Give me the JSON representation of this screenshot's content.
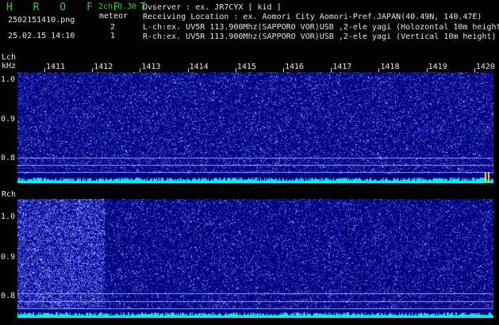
{
  "header": {
    "app_title": "H R O F F T",
    "mode": "2ch",
    "version": "0.30",
    "filename": "2502151410.png",
    "meteor_label": "meteor",
    "meteor_lch": "2",
    "meteor_rch": "1",
    "datetime": "25.02.15 14:10",
    "observer": "Ovserver           : ex. JR7CYX [ kid ]",
    "location": "Receiving Location : ex. Aomori City Aomori-Pref.JAPAN(40.49N, 140.47E)",
    "lch_info": "L-ch:ex. UV5R 113.900Mhz(SAPPORO VOR)USB ,2-ele yagi (Holozontal 10m height)",
    "rch_info": "R-ch:ex. UV5R 113.900Mhz(SAPPORO VOR)USB ,2-ele yagi (Vertical 10m height)"
  },
  "lch": {
    "label": "Lch",
    "unit": "kHz",
    "y_ticks": [
      "1.0",
      "0.9",
      "0.8"
    ]
  },
  "rch": {
    "label": "Rch",
    "y_ticks": [
      "1.0",
      "0.9",
      "0.8"
    ]
  },
  "time_axis": [
    "1411",
    "1412",
    "1413",
    "1414",
    "1415",
    "1416",
    "1417",
    "1418",
    "1419",
    "1420"
  ],
  "colors": {
    "title_green": "#2bd12b",
    "panel_blue": "#00007a",
    "noise_cyan": "#19e6f0",
    "marker_yellow": "#ffe000"
  }
}
